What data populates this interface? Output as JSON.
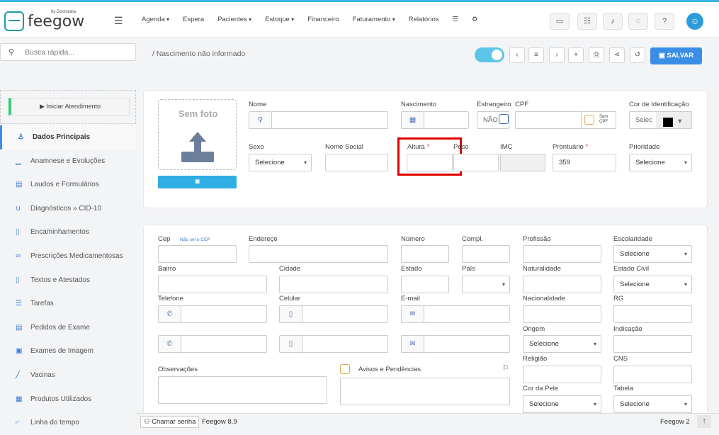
{
  "app": {
    "logo_text": "feegow",
    "logo_by": "by Doctoralia"
  },
  "menu": [
    {
      "label": "Agenda",
      "dd": true
    },
    {
      "label": "Espera",
      "dd": false
    },
    {
      "label": "Pacientes",
      "dd": true
    },
    {
      "label": "Estoque",
      "dd": true
    },
    {
      "label": "Financeiro",
      "dd": false
    },
    {
      "label": "Faturamento",
      "dd": true
    },
    {
      "label": "Relatórios",
      "dd": false
    }
  ],
  "search": {
    "placeholder": "Busca rápida..."
  },
  "breadcrumb": {
    "text": "/  Nascimento não informado"
  },
  "toolbar": {
    "save_label": "SALVAR"
  },
  "sidebar": {
    "start_label": "▶ Iniciar Atendimento",
    "items": [
      {
        "label": "Dados Principais",
        "icon": "user-icon"
      },
      {
        "label": "Anamnese e Evoluções",
        "icon": "chart-icon"
      },
      {
        "label": "Laudos e Formulários",
        "icon": "clipboard-icon"
      },
      {
        "label": "Diagnósticos » CID-10",
        "icon": "stethoscope-icon"
      },
      {
        "label": "Encaminhamentos",
        "icon": "document-icon"
      },
      {
        "label": "Prescrições Medicamentosas",
        "icon": "pills-icon"
      },
      {
        "label": "Textos e Atestados",
        "icon": "file-icon"
      },
      {
        "label": "Tarefas",
        "icon": "tasks-icon"
      },
      {
        "label": "Pedidos de Exame",
        "icon": "clipboard-icon"
      },
      {
        "label": "Exames de Imagem",
        "icon": "image-icon"
      },
      {
        "label": "Vacinas",
        "icon": "syringe-icon"
      },
      {
        "label": "Produtos Utilizados",
        "icon": "box-icon"
      },
      {
        "label": "Linha do tempo",
        "icon": "timeline-icon"
      }
    ]
  },
  "photo": {
    "label": "Sem foto"
  },
  "form1": {
    "nome": "Nome",
    "nascimento": "Nascimento",
    "estrangeiro": "Estrangeiro",
    "estrangeiro_value": "NÃO",
    "cpf": "CPF",
    "sem_cpf": "Sem CPF",
    "cor": "Cor de Identificação",
    "cor_value": "Selec",
    "sexo": "Sexo",
    "sexo_value": "Selecione",
    "nome_social": "Nome Social",
    "altura": "Altura",
    "peso": "Peso",
    "imc": "IMC",
    "prontuario": "Prontuário",
    "prontuario_value": "359",
    "prioridade": "Prioridade",
    "prioridade_value": "Selecione"
  },
  "form2": {
    "cep": "Cep",
    "nao_sei_cep": "Não sei o CEP",
    "endereco": "Endereço",
    "numero": "Número",
    "compl": "Compl.",
    "profissao": "Profissão",
    "escolaridade": "Escolaridade",
    "bairro": "Bairro",
    "cidade": "Cidade",
    "estado": "Estado",
    "pais": "País",
    "naturalidade": "Naturalidade",
    "estado_civil": "Estado Civil",
    "telefone": "Telefone",
    "celular": "Celular",
    "email": "E-mail",
    "nacionalidade": "Nacionalidade",
    "rg": "RG",
    "origem": "Origem",
    "indicacao": "Indicação",
    "religiao": "Religião",
    "cns": "CNS",
    "observacoes": "Observações",
    "avisos": "Avisos e Pendências",
    "cor_pele": "Cor da Pele",
    "tabela": "Tabela",
    "selecione": "Selecione"
  },
  "footer": {
    "chamar": "Chamar senha",
    "version": "Feegow 8.9",
    "right": "Feegow 2"
  }
}
